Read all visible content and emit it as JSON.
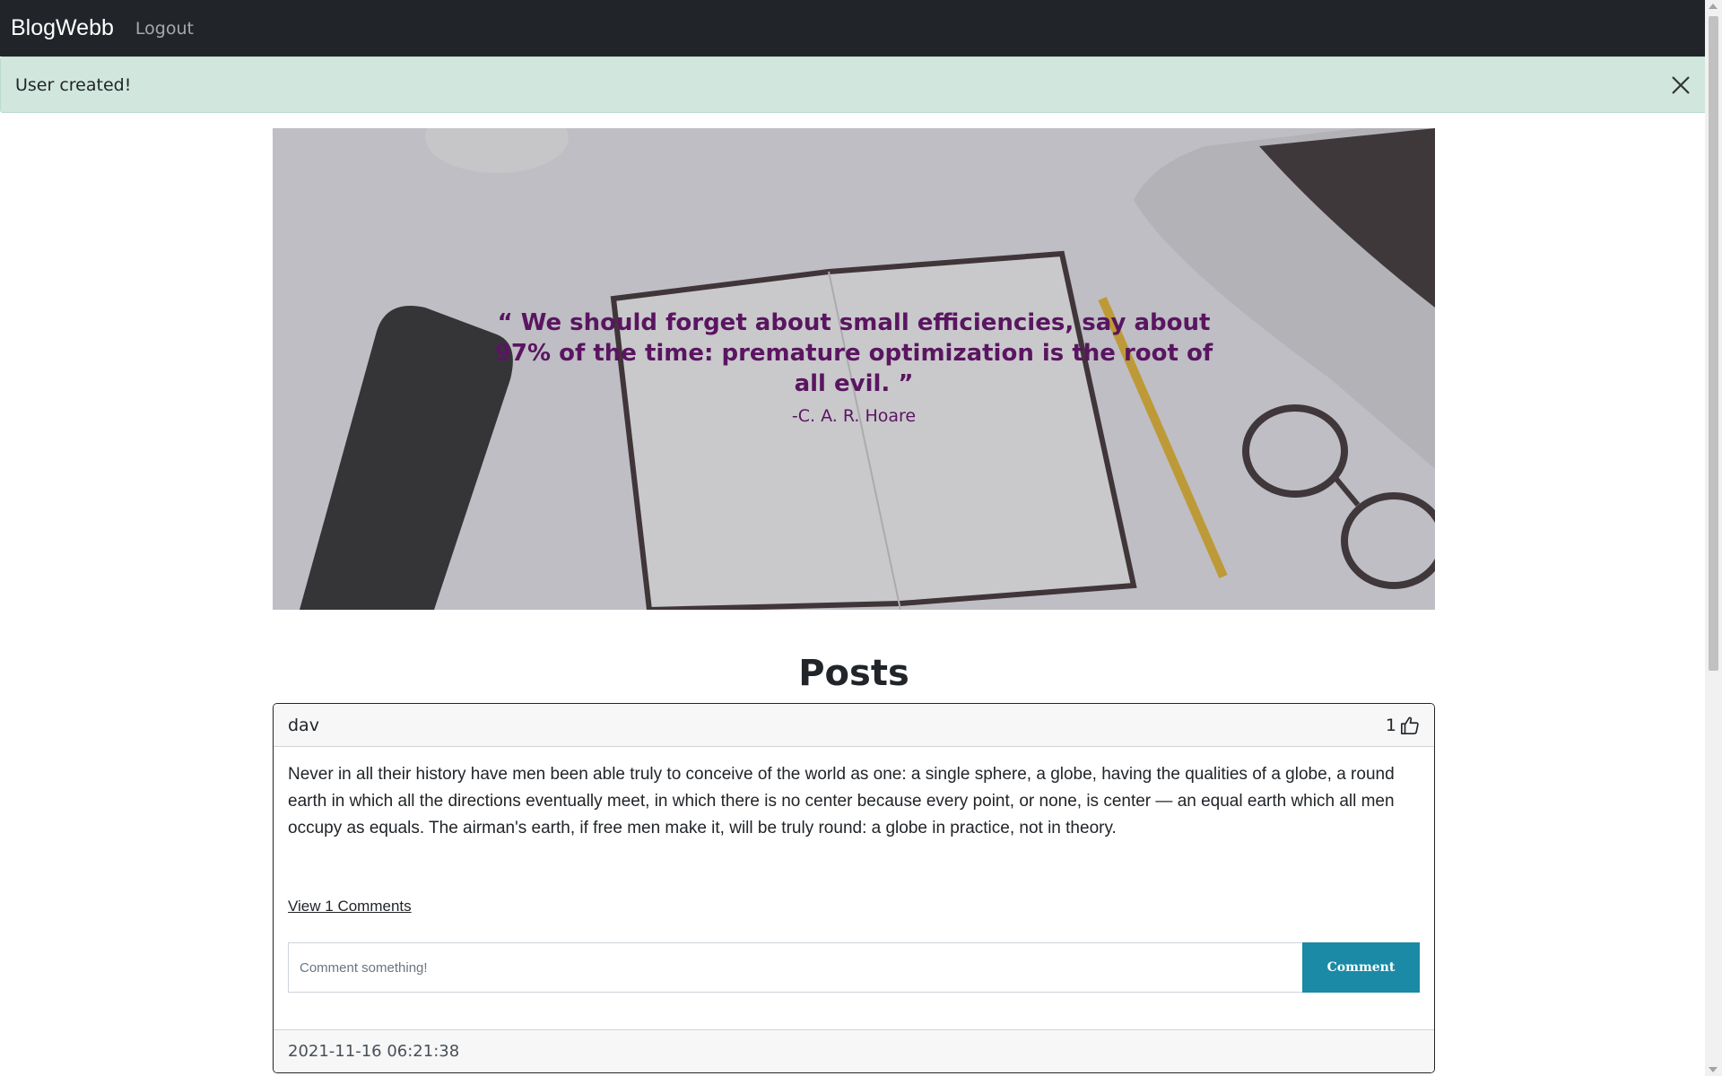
{
  "navbar": {
    "brand": "BlogWebb",
    "logout": "Logout"
  },
  "alert": {
    "message": "User created!",
    "close_icon": "close-icon"
  },
  "hero": {
    "quote": "“ We should forget about small efficiencies, say about 97% of the time: premature optimization is the root of all evil. ”",
    "author": "-C. A. R. Hoare"
  },
  "posts": {
    "title": "Posts",
    "items": [
      {
        "author": "dav",
        "likes": "1",
        "like_icon": "thumbs-up-icon",
        "body": "Never in all their history have men been able truly to conceive of the world as one: a single sphere, a globe, having the qualities of a globe, a round earth in which all the directions eventually meet, in which there is no center because every point, or none, is center — an equal earth which all men occupy as equals. The airman's earth, if free men make it, will be truly round: a globe in practice, not in theory.",
        "view_comments": "View 1 Comments",
        "comment_placeholder": "Comment something!",
        "comment_button": "Comment",
        "timestamp": "2021-11-16 06:21:38"
      }
    ]
  },
  "colors": {
    "navbar": "#212529",
    "alert_bg": "#d1e7dd",
    "quote": "#5a1560",
    "comment_button": "#1a8aa6"
  }
}
